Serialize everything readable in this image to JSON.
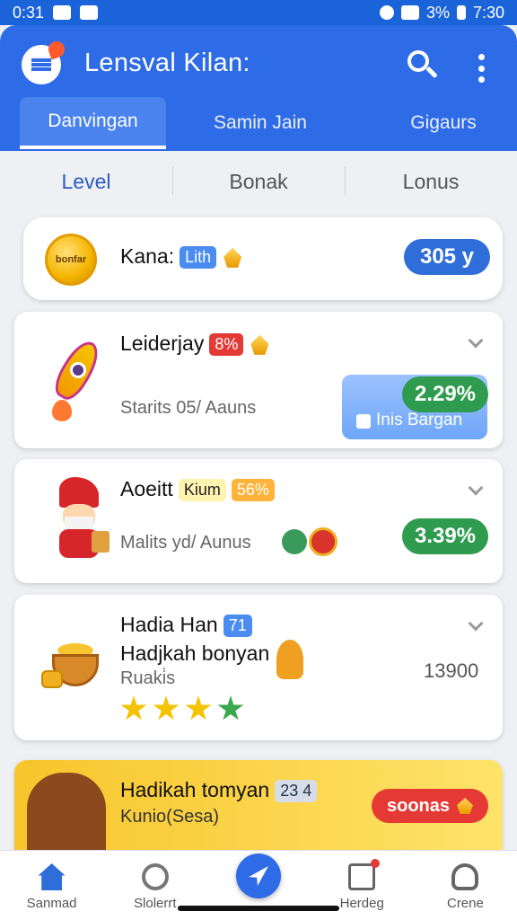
{
  "status_bar": {
    "time_left": "0:31",
    "battery": "3%",
    "time_right": "7:30"
  },
  "app_bar": {
    "title": "Lensval Kilan:",
    "tabs": [
      {
        "label": "Danvingan"
      },
      {
        "label": "Samin Jain"
      },
      {
        "label": "Gigaurs"
      }
    ]
  },
  "sub_tabs": [
    {
      "label": "Level"
    },
    {
      "label": "Bonak"
    },
    {
      "label": "Lonus"
    }
  ],
  "cards": {
    "kana": {
      "coin_text": "bonfar",
      "title": "Kana:",
      "chip": "Lith",
      "value": "305 y"
    },
    "leiderjay": {
      "title": "Leiderjay",
      "chip": "8%",
      "subtitle": "Starits 05/ Aauns",
      "pill": "2.29%",
      "promo": "Inis Bargan"
    },
    "aoeitt": {
      "title": "Aoeitt",
      "chip_a": "Kium",
      "chip_b": "56%",
      "subtitle": "Malits yd/ Aunus",
      "pill": "3.39%"
    },
    "hadia": {
      "title": "Hadia Han",
      "chip": "71",
      "title2": "Hadjkah bonyan",
      "subtitle": "Ruaki̇s",
      "value": "13900",
      "stars": 4
    },
    "promo": {
      "title": "Hadikah tomyan",
      "chip": "23 4",
      "subtitle": "Kunio(Sesa)",
      "button": "soonas"
    }
  },
  "bottom_nav": [
    {
      "label": "Sanmad",
      "icon": "home-icon"
    },
    {
      "label": "Slolerrt",
      "icon": "gear-icon"
    },
    {
      "label": "",
      "icon": "send-icon"
    },
    {
      "label": "Herdeg",
      "icon": "document-icon"
    },
    {
      "label": "Crene",
      "icon": "person-icon"
    }
  ],
  "colors": {
    "primary": "#2e6be6",
    "green_pill": "#2e9b4e",
    "blue_pill": "#2f6ed8",
    "promo_red": "#e53935",
    "promo_bg": "#ffd64a"
  }
}
